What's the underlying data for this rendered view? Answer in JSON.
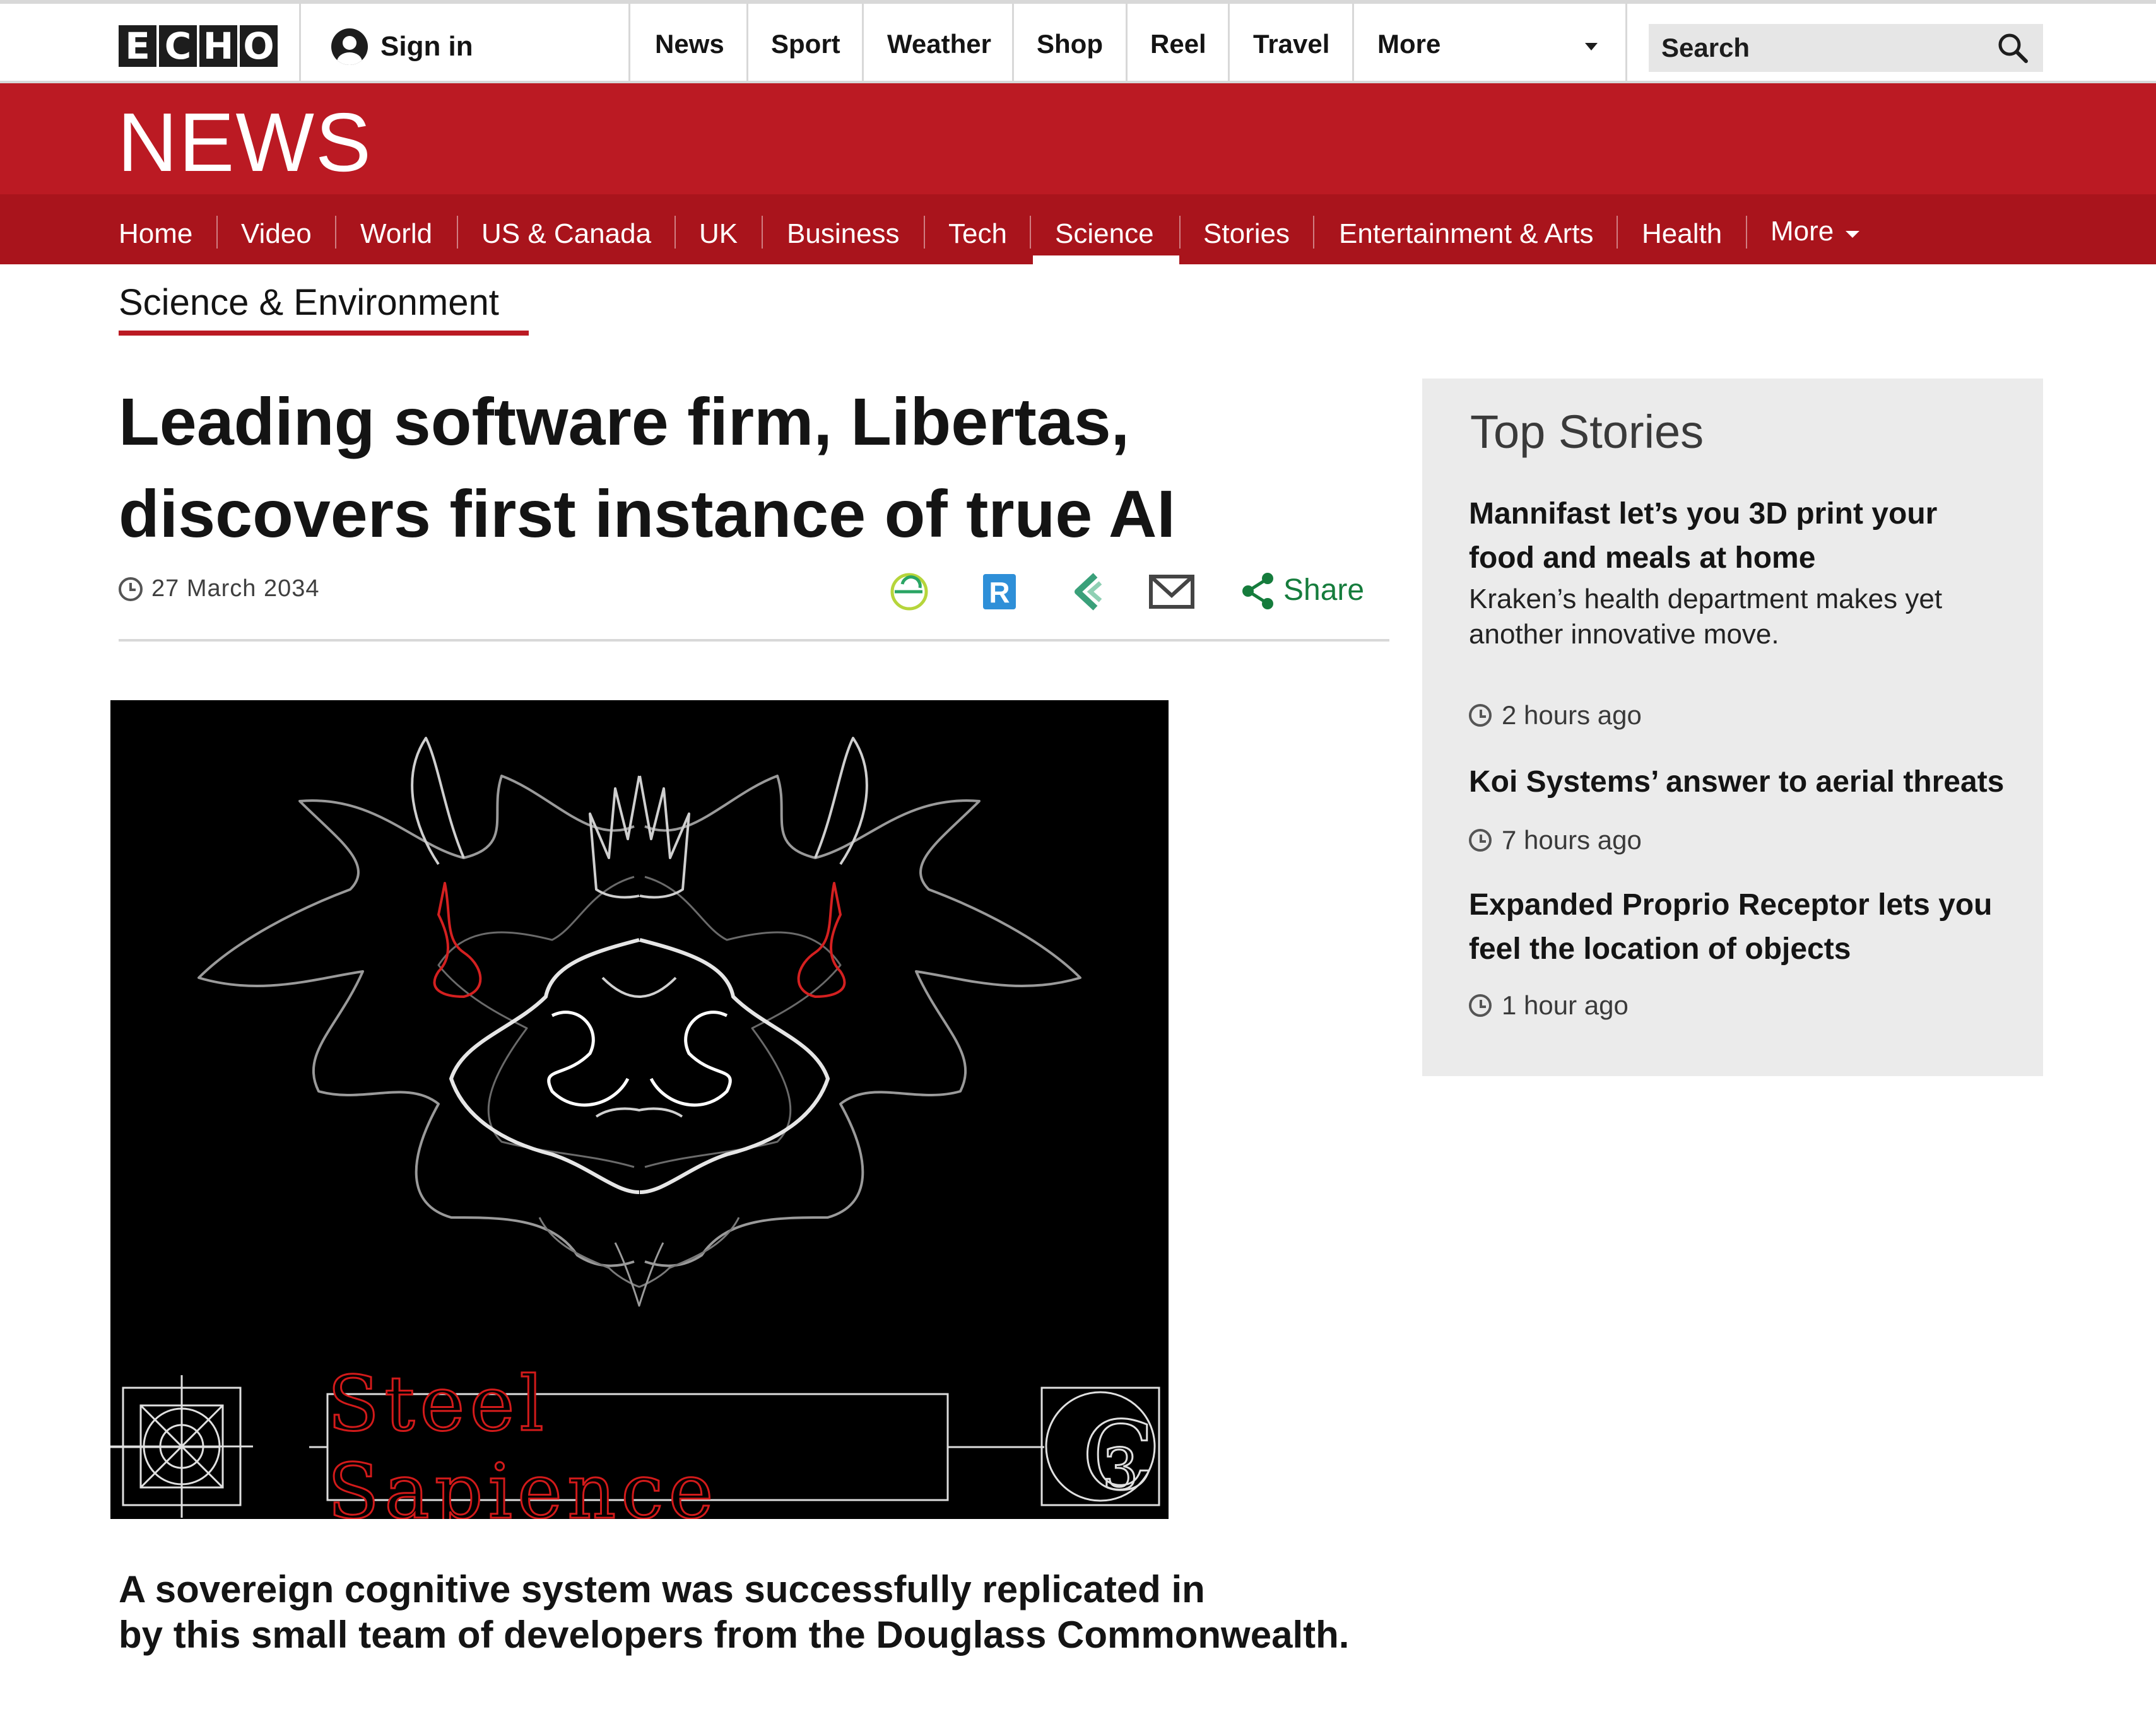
{
  "masthead": {
    "logo_text": "ECHO",
    "sign_in_label": "Sign in",
    "nav": [
      "News",
      "Sport",
      "Weather",
      "Shop",
      "Reel",
      "Travel",
      "More"
    ],
    "search_placeholder": "Search"
  },
  "news_band": {
    "title": "NEWS",
    "subnav": [
      "Home",
      "Video",
      "World",
      "US & Canada",
      "UK",
      "Business",
      "Tech",
      "Science",
      "Stories",
      "Entertainment & Arts",
      "Health",
      "More"
    ],
    "active_item": "Science"
  },
  "section": {
    "label": "Science & Environment"
  },
  "article": {
    "headline_line1": "Leading software firm, Libertas,",
    "headline_line2": "discovers first instance of true AI",
    "date": "27 March 2034",
    "share_label": "Share",
    "share_icons": [
      "echo-share-icon",
      "r-share-icon",
      "chevron-share-icon",
      "email-icon",
      "share-icon"
    ],
    "image_text": "Steel Sapience",
    "caption_line1": "A sovereign cognitive system was successfully replicated in",
    "caption_line2": "by this small team of developers from the Douglass Commonwealth."
  },
  "top_stories": {
    "heading": "Top Stories",
    "stories": [
      {
        "title_line1": "Mannifast let’s you 3D print your",
        "title_line2": "food and meals at home",
        "sub_line1": "Kraken’s health department makes yet",
        "sub_line2": "another innovative move.",
        "time": "2 hours ago"
      },
      {
        "title_line1": "Koi Systems’ answer to aerial threats",
        "title_line2": "",
        "time": "7 hours ago"
      },
      {
        "title_line1": "Expanded Proprio Receptor lets you",
        "title_line2": "feel the location of objects",
        "time": "1 hour ago"
      }
    ]
  },
  "colors": {
    "brand_red": "#bb1a23",
    "subnav_red": "#a9141c",
    "share_green": "#157c3c",
    "panel_gray": "#ebebeb"
  }
}
